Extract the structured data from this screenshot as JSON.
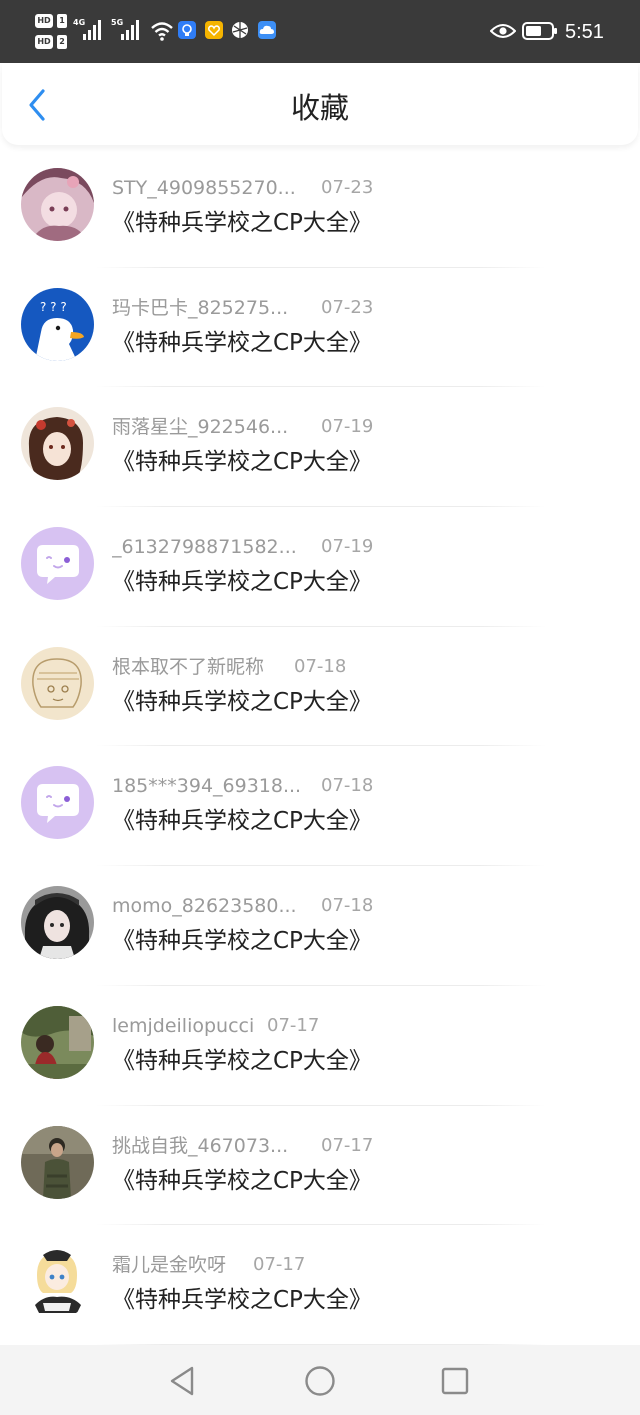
{
  "status_bar": {
    "sim1_label": "HD",
    "sim1_num": "1",
    "sim2_label": "HD",
    "sim2_num": "2",
    "network1": "4G",
    "network2": "5G",
    "time": "5:51",
    "icons": [
      "wifi-icon",
      "bulb-app-icon",
      "heart-app-icon",
      "ball-app-icon",
      "cloud-app-icon",
      "eye-icon",
      "battery-icon"
    ]
  },
  "header": {
    "title": "收藏",
    "back_icon": "chevron-left-icon"
  },
  "items": [
    {
      "username": "STY_4909855270...",
      "date": "07-23",
      "book_title": "《特种兵学校之CP大全》",
      "avatar_color": "#c9a0b4"
    },
    {
      "username": "玛卡巴卡_825275...",
      "date": "07-23",
      "book_title": "《特种兵学校之CP大全》",
      "avatar_color": "#1a5fbf"
    },
    {
      "username": "雨落星尘_922546...",
      "date": "07-19",
      "book_title": "《特种兵学校之CP大全》",
      "avatar_color": "#e8d9cc"
    },
    {
      "username": "_6132798871582...",
      "date": "07-19",
      "book_title": "《特种兵学校之CP大全》",
      "avatar_color": "#d7c2f2"
    },
    {
      "username": "根本取不了新昵称",
      "date": "07-18",
      "book_title": "《特种兵学校之CP大全》",
      "avatar_color": "#efe0c4"
    },
    {
      "username": "185***394_69318...",
      "date": "07-18",
      "book_title": "《特种兵学校之CP大全》",
      "avatar_color": "#d7c2f2"
    },
    {
      "username": "momo_82623580...",
      "date": "07-18",
      "book_title": "《特种兵学校之CP大全》",
      "avatar_color": "#3a3a3a"
    },
    {
      "username": "lemjdeiliopucci",
      "date": "07-17",
      "book_title": "《特种兵学校之CP大全》",
      "avatar_color": "#5a6b3e"
    },
    {
      "username": "挑战自我_467073...",
      "date": "07-17",
      "book_title": "《特种兵学校之CP大全》",
      "avatar_color": "#4e4a3c"
    },
    {
      "username": "霜儿是金吹呀",
      "date": "07-17",
      "book_title": "《特种兵学校之CP大全》",
      "avatar_color": "#f5ede4"
    }
  ],
  "navbar": {
    "icons": [
      "back-triangle-icon",
      "home-circle-icon",
      "recent-square-icon"
    ]
  },
  "colors": {
    "accent": "#2e8ef0",
    "status_bar_bg": "#3a3a3a",
    "text_primary": "#222222",
    "text_secondary": "#9a9a9a"
  }
}
